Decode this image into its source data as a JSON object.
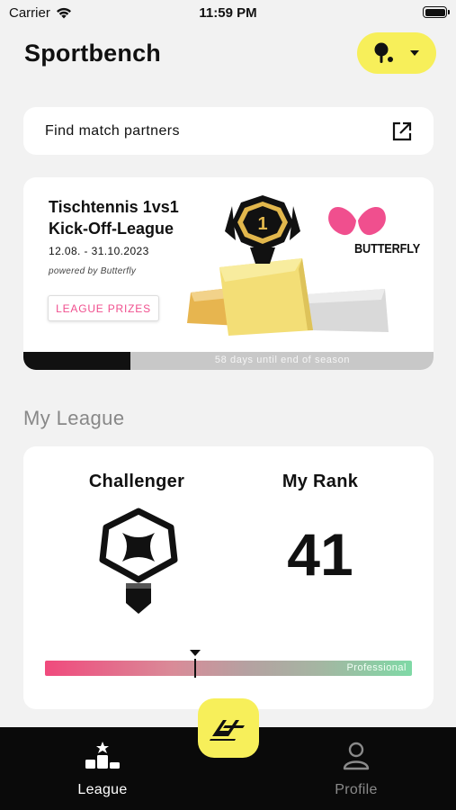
{
  "status_bar": {
    "carrier": "Carrier",
    "time": "11:59 PM"
  },
  "header": {
    "title": "Sportbench",
    "sport_icon": "table-tennis-paddle-icon",
    "dropdown_icon": "caret-down-icon"
  },
  "find_partners": {
    "label": "Find match partners",
    "icon": "external-link-icon"
  },
  "league_banner": {
    "title_line1": "Tischtennis 1vs1",
    "title_line2": "Kick-Off-League",
    "dates": "12.08. - 31.10.2023",
    "powered_by": "powered by Butterfly",
    "prizes_button": "LEAGUE PRIZES",
    "sponsor": "BUTTERFLY",
    "podium_rank": "1",
    "progress_text": "58 days until end of season",
    "progress_fraction": 0.26
  },
  "my_league": {
    "section_title": "My League",
    "tier_label": "Challenger",
    "rank_label": "My Rank",
    "rank_value": "41",
    "scale_end_label": "Professional",
    "scale_position_fraction": 0.41
  },
  "bottom_nav": {
    "league_label": "League",
    "profile_label": "Profile"
  },
  "colors": {
    "accent_yellow": "#f7ef5a",
    "accent_pink": "#f04f8e",
    "nav_bg": "#0a0a0a"
  }
}
